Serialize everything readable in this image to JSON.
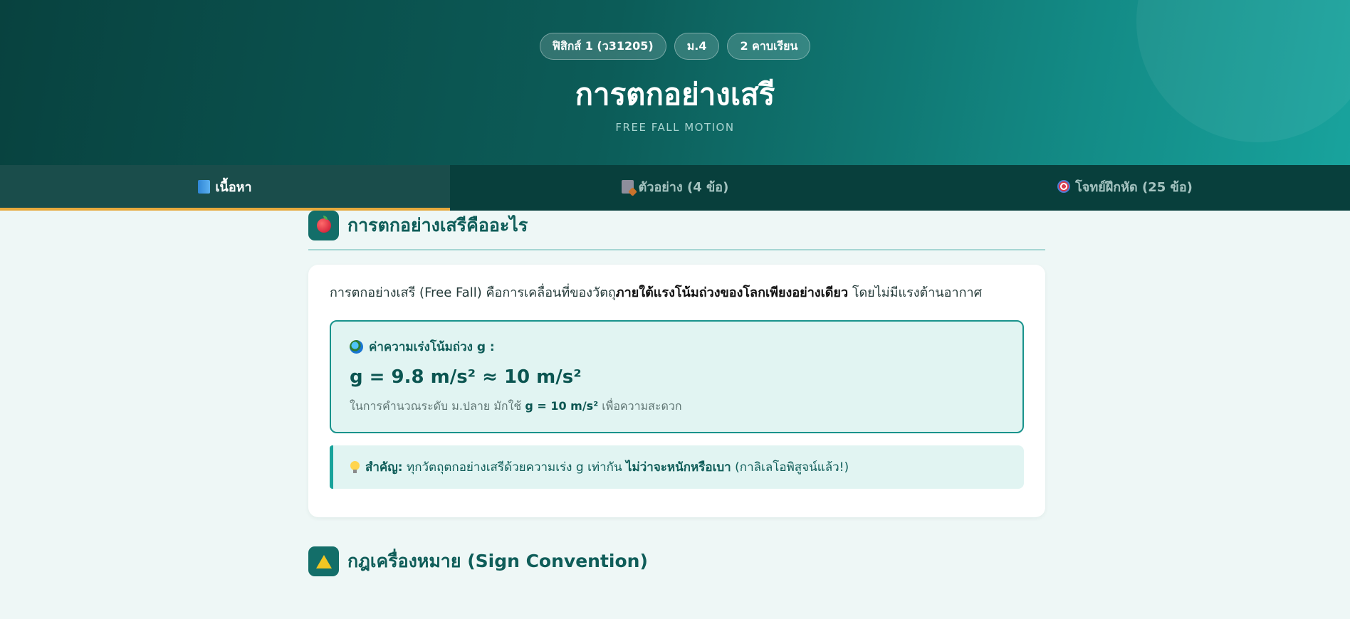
{
  "header": {
    "badges": [
      "ฟิสิกส์ 1 (ว31205)",
      "ม.4",
      "2 คาบเรียน"
    ],
    "title": "การตกอย่างเสรี",
    "subtitle": "FREE FALL MOTION"
  },
  "tabs": [
    {
      "icon": "book-icon",
      "label": "เนื้อหา",
      "active": true
    },
    {
      "icon": "page-icon",
      "label": "ตัวอย่าง (4 ข้อ)",
      "active": false
    },
    {
      "icon": "target-icon",
      "label": "โจทย์ฝึกหัด (25 ข้อ)",
      "active": false
    }
  ],
  "section1": {
    "icon": "apple-icon",
    "title": "การตกอย่างเสรีคืออะไร",
    "lead_pre": "การตกอย่างเสรี (Free Fall) คือการเคลื่อนที่ของวัตถุ",
    "lead_bold": "ภายใต้แรงโน้มถ่วงของโลกเพียงอย่างเดียว",
    "lead_post": " โดยไม่มีแรงต้านอากาศ",
    "box": {
      "icon": "globe-icon",
      "label": "ค่าความเร่งโน้มถ่วง g :",
      "formula": "g = 9.8 m/s² ≈ 10 m/s²",
      "note_pre": "ในการคำนวณระดับ ม.ปลาย มักใช้ ",
      "note_bold": "g = 10 m/s²",
      "note_post": " เพื่อความสะดวก"
    },
    "tip": {
      "icon": "lightbulb-icon",
      "bold": "สำคัญ:",
      "text": " ทุกวัตถุตกอย่างเสรีด้วยความเร่ง g เท่ากัน ",
      "bold2": "ไม่ว่าจะหนักหรือเบา",
      "text2": " (กาลิเลโอพิสูจน์แล้ว!)"
    }
  },
  "section2": {
    "icon": "warning-icon",
    "title": "กฎเครื่องหมาย (Sign Convention)"
  },
  "colors": {
    "hero_start": "#08423f",
    "hero_end": "#18a39d",
    "tab_active_underline": "#e7a93c",
    "accent": "#136e69"
  }
}
